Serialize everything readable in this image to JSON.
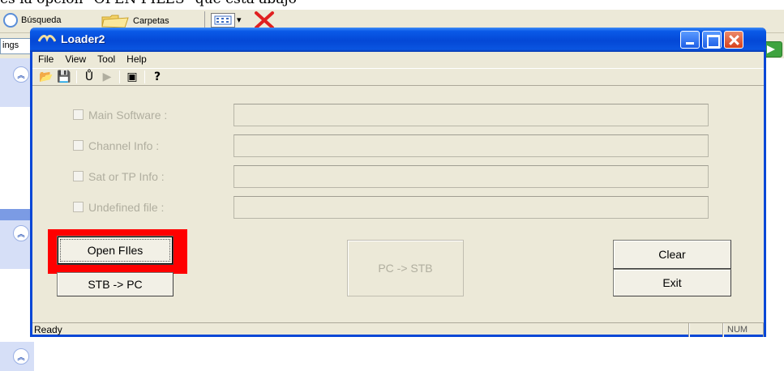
{
  "caption": "es la opcion \"OPEN FILES\" que esta abajo",
  "background": {
    "toolbar": {
      "search_label": "Búsqueda",
      "folders_label": "Carpetas",
      "views_caret": "▾"
    },
    "address": {
      "field_text": "ings"
    },
    "sidebar": {
      "expander_glyph": "︽"
    }
  },
  "window": {
    "title": "Loader2",
    "menu": [
      "File",
      "View",
      "Tool",
      "Help"
    ],
    "toolbar_tools": [
      {
        "name": "open-folder-icon",
        "glyph": "📂"
      },
      {
        "name": "save-icon",
        "glyph": "💾"
      },
      {
        "name": "u-tool-icon",
        "glyph": "Ů"
      },
      {
        "name": "play-icon",
        "glyph": "▶"
      },
      {
        "name": "screen-icon",
        "glyph": "▣"
      },
      {
        "name": "help-icon",
        "glyph": "?"
      }
    ],
    "files": [
      {
        "label": "Main Software :"
      },
      {
        "label": "Channel Info :"
      },
      {
        "label": "Sat or TP Info :"
      },
      {
        "label": "Undefined file :"
      }
    ],
    "buttons": {
      "open_files": "Open FIles",
      "stb_to_pc": "STB -> PC",
      "pc_to_stb": "PC -> STB",
      "clear": "Clear",
      "exit": "Exit"
    },
    "status": {
      "text": "Ready",
      "num": "NUM"
    }
  },
  "colors": {
    "titlebar": "#0448d6",
    "highlight": "#ff0000",
    "window_bg": "#ece9d8"
  }
}
